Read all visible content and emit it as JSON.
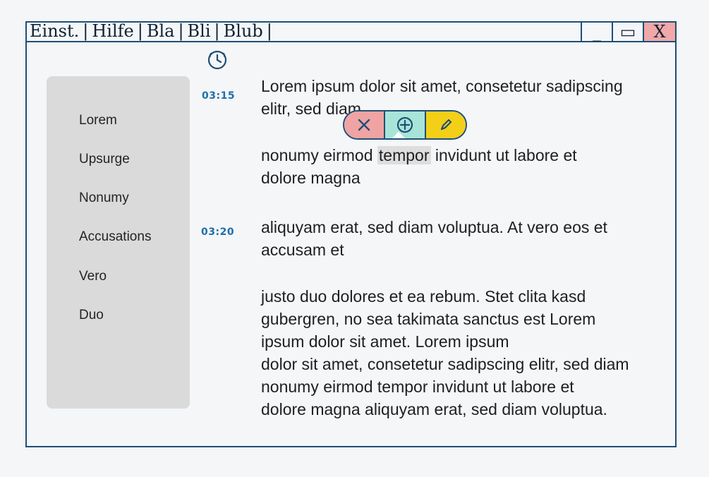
{
  "menu": {
    "items": [
      "Einst.",
      "Hilfe",
      "Bla",
      "Bli",
      "Blub"
    ]
  },
  "window_controls": {
    "minimize": "_",
    "maximize": "▭",
    "close": "X"
  },
  "sidebar": {
    "items": [
      "Lorem",
      "Upsurge",
      "Nonumy",
      "Accusations",
      "Vero",
      "Duo"
    ]
  },
  "times": {
    "first": "03:15",
    "second": "03:20"
  },
  "content": {
    "p1_line1": "Lorem ipsum dolor sit amet, consetetur sadipscing",
    "p1_line2": "elitr, sed diam",
    "p2_before": "nonumy eirmod ",
    "p2_highlight": "tempor",
    "p2_after": " invidunt ut labore et",
    "p2_line2": "dolore magna",
    "p3_line1": "aliquyam erat, sed diam voluptua. At vero eos et",
    "p3_line2": "accusam et",
    "p4_line1": "justo duo dolores et ea rebum. Stet clita kasd",
    "p4_line2": "gubergren, no sea takimata sanctus est Lorem",
    "p4_line3": "ipsum dolor sit amet. Lorem ipsum",
    "p4_line4": "dolor sit amet, consetetur sadipscing elitr, sed diam",
    "p4_line5": "nonumy eirmod tempor invidunt ut labore et",
    "p4_line6": "dolore magna aliquyam erat, sed diam voluptua."
  },
  "tooltip": {
    "icons": [
      "close-icon",
      "add-circle-icon",
      "pencil-icon"
    ]
  },
  "colors": {
    "frame": "#1f4f76",
    "sidebar": "#dadada",
    "time": "#1f6ea8",
    "delete": "#f0a3a3",
    "add": "#a9e4d8",
    "edit": "#f3cf18"
  }
}
